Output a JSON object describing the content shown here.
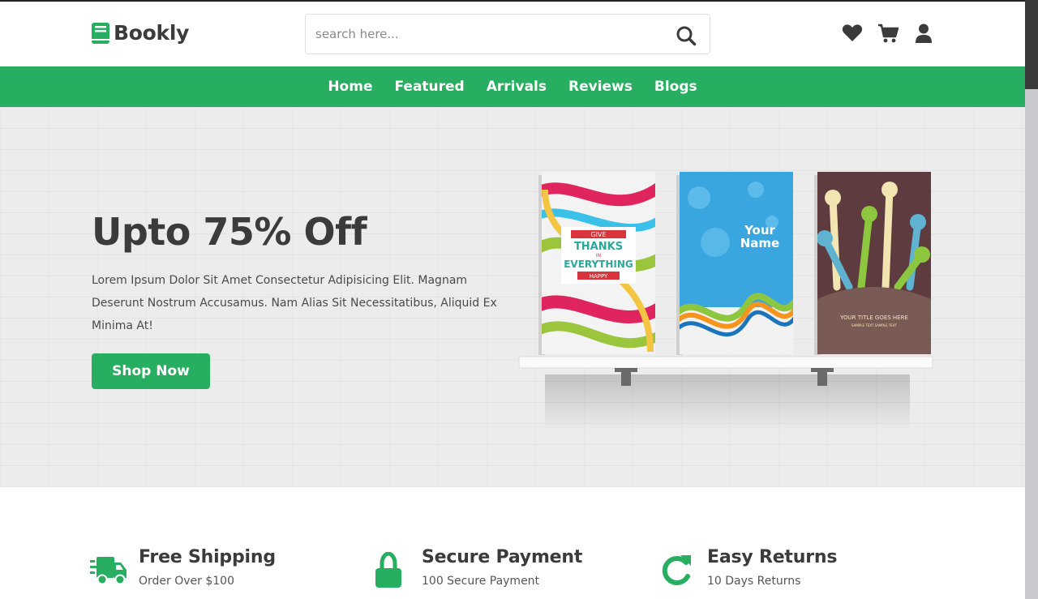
{
  "brand": {
    "name": "Bookly",
    "accent": "#27ae60"
  },
  "search": {
    "placeholder": "search here..."
  },
  "header_icons": [
    "heart-icon",
    "cart-icon",
    "user-icon"
  ],
  "nav": {
    "items": [
      "Home",
      "Featured",
      "Arrivals",
      "Reviews",
      "Blogs"
    ]
  },
  "hero": {
    "title": "Upto 75% Off",
    "text": "Lorem Ipsum Dolor Sit Amet Consectetur Adipisicing Elit. Magnam Deserunt Nostrum Accusamus. Nam Alias Sit Necessitatibus, Aliquid Ex Minima At!",
    "button": "Shop Now",
    "books": {
      "book1": {
        "top": "GIVE",
        "line1": "THANKS",
        "mid": "IN",
        "line2": "EVERYTHING",
        "bottom": "HAPPY"
      },
      "book2": {
        "line1": "Your",
        "line2": "Name"
      },
      "book3": {
        "title": "YOUR TITLE GOES HERE",
        "subtitle": "SAMPLE TEXT SAMPLE TEXT"
      }
    }
  },
  "features": [
    {
      "icon": "truck-icon",
      "title": "Free Shipping",
      "subtitle": "Order Over $100"
    },
    {
      "icon": "lock-icon",
      "title": "Secure Payment",
      "subtitle": "100 Secure Payment"
    },
    {
      "icon": "redo-icon",
      "title": "Easy Returns",
      "subtitle": "10 Days Returns"
    }
  ]
}
